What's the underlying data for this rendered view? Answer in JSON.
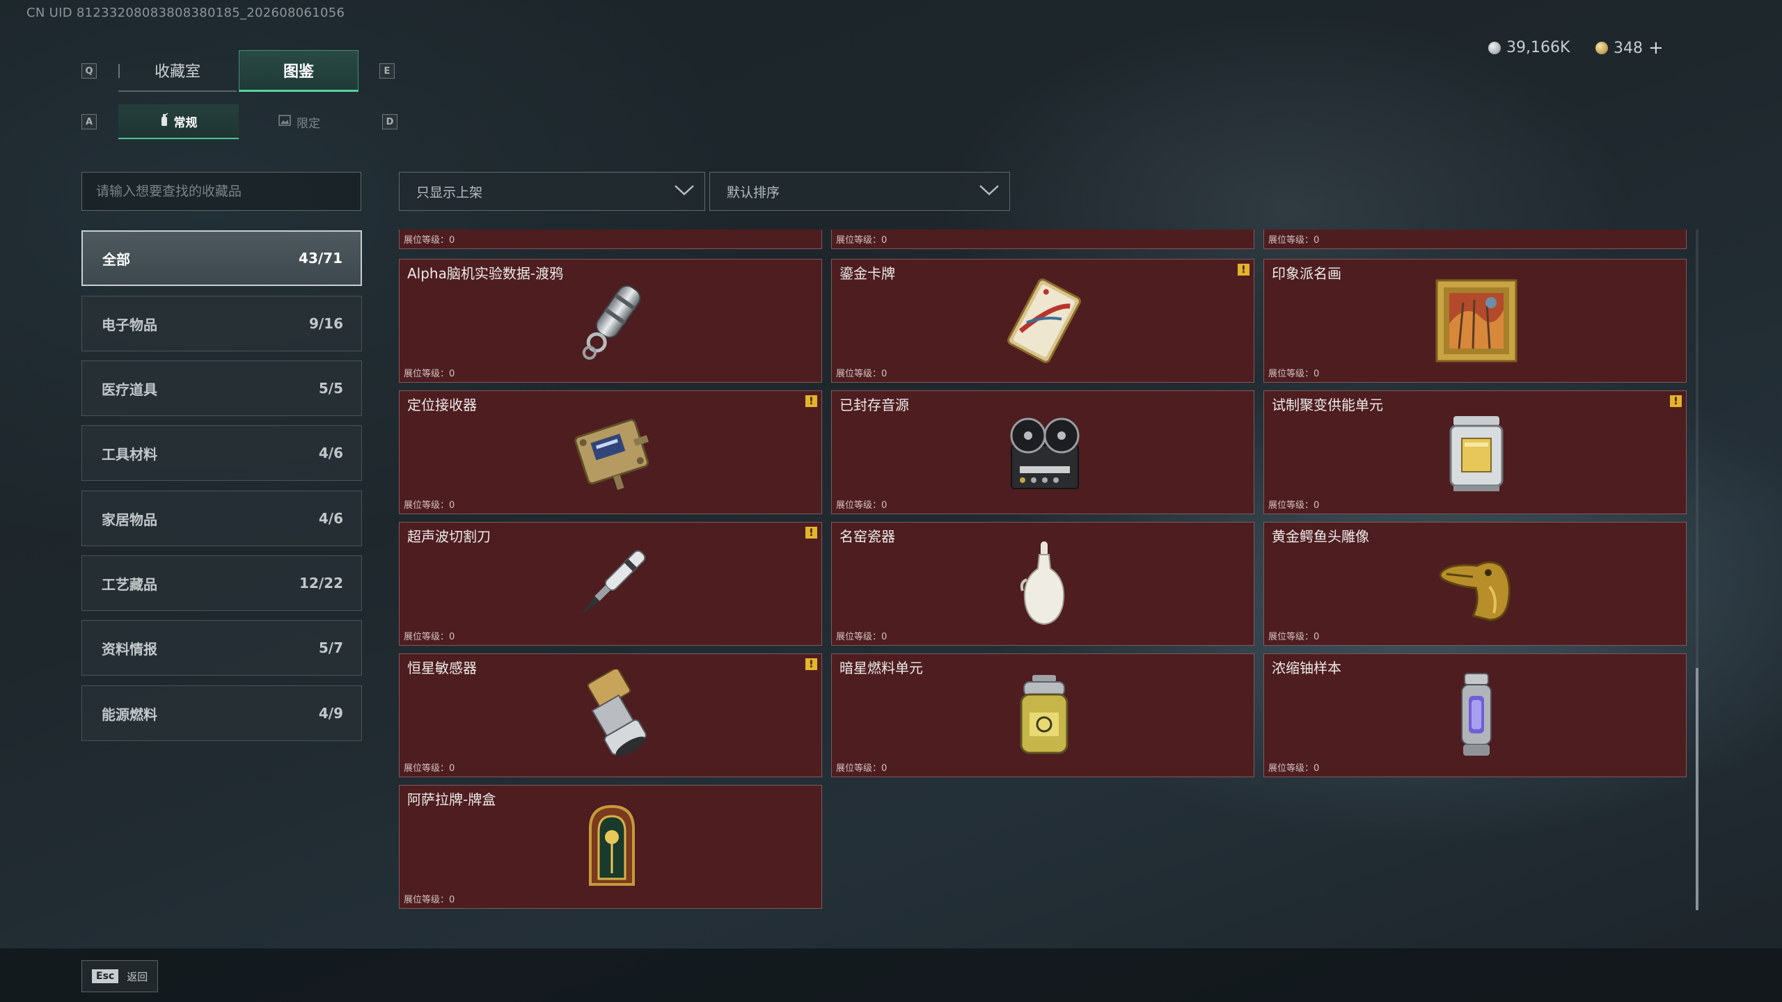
{
  "uid_text": "CN UID 81233208083808380185_202608061056",
  "keys": {
    "prev_tab": "Q",
    "next_tab": "E",
    "prev_sub": "A",
    "next_sub": "D"
  },
  "tabs": [
    {
      "label": "收藏室",
      "active": false
    },
    {
      "label": "图鉴",
      "active": true
    }
  ],
  "subtabs": [
    {
      "label": "常规",
      "icon": "fire-extinguisher-icon",
      "active": true
    },
    {
      "label": "限定",
      "icon": "image-icon",
      "active": false
    }
  ],
  "currency": {
    "silver": {
      "value": "39,166K",
      "icon": "silver-coin-icon"
    },
    "gold": {
      "value": "348",
      "icon": "gold-coin-icon"
    },
    "add_label": "+"
  },
  "search": {
    "placeholder": "请输入想要查找的收藏品",
    "value": ""
  },
  "filters": {
    "availability": "只显示上架",
    "sort": "默认排序"
  },
  "categories": [
    {
      "label": "全部",
      "count": "43/71",
      "active": true
    },
    {
      "label": "电子物品",
      "count": "9/16"
    },
    {
      "label": "医疗道具",
      "count": "5/5"
    },
    {
      "label": "工具材料",
      "count": "4/6"
    },
    {
      "label": "家居物品",
      "count": "4/6"
    },
    {
      "label": "工艺藏品",
      "count": "12/22"
    },
    {
      "label": "资料情报",
      "count": "5/7"
    },
    {
      "label": "能源燃料",
      "count": "4/9"
    }
  ],
  "level_label": "展位等级：0",
  "items": [
    {
      "name": "",
      "level": "展位等级：0",
      "alert": false,
      "icon": "partial-item-icon"
    },
    {
      "name": "",
      "level": "展位等级：0",
      "alert": false,
      "icon": "partial-item-icon"
    },
    {
      "name": "",
      "level": "展位等级：0",
      "alert": false,
      "icon": "partial-item-icon"
    },
    {
      "name": "Alpha脑机实验数据-渡鸦",
      "level": "展位等级：0",
      "alert": false,
      "icon": "data-drive-icon"
    },
    {
      "name": "鎏金卡牌",
      "level": "展位等级：0",
      "alert": true,
      "icon": "gilded-card-icon"
    },
    {
      "name": "印象派名画",
      "level": "展位等级：0",
      "alert": false,
      "icon": "painting-icon"
    },
    {
      "name": "定位接收器",
      "level": "展位等级：0",
      "alert": true,
      "icon": "receiver-icon"
    },
    {
      "name": "已封存音源",
      "level": "展位等级：0",
      "alert": false,
      "icon": "tape-recorder-icon"
    },
    {
      "name": "试制聚变供能单元",
      "level": "展位等级：0",
      "alert": true,
      "icon": "fusion-unit-icon"
    },
    {
      "name": "超声波切割刀",
      "level": "展位等级：0",
      "alert": true,
      "icon": "ultrasonic-knife-icon"
    },
    {
      "name": "名窑瓷器",
      "level": "展位等级：0",
      "alert": false,
      "icon": "porcelain-vase-icon"
    },
    {
      "name": "黄金鳄鱼头雕像",
      "level": "展位等级：0",
      "alert": false,
      "icon": "gold-crocodile-icon"
    },
    {
      "name": "恒星敏感器",
      "level": "展位等级：0",
      "alert": true,
      "icon": "star-sensor-icon"
    },
    {
      "name": "暗星燃料单元",
      "level": "展位等级：0",
      "alert": false,
      "icon": "fuel-canister-icon"
    },
    {
      "name": "浓缩铀样本",
      "level": "展位等级：0",
      "alert": false,
      "icon": "uranium-sample-icon"
    },
    {
      "name": "阿萨拉牌-牌盒",
      "level": "展位等级：0",
      "alert": false,
      "icon": "card-box-icon"
    }
  ],
  "alert_glyph": "!",
  "footer": {
    "esc_key": "Esc",
    "back_label": "返回"
  }
}
